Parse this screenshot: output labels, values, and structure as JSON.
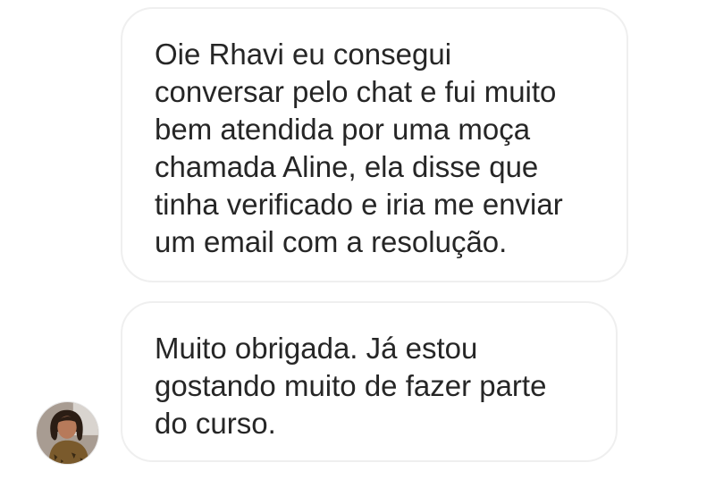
{
  "conversation": {
    "messages": [
      {
        "sender": "other",
        "text": "Oie Rhavi eu consegui\nconversar pelo chat e fui muito\nbem atendida por  uma moça\nchamada Aline, ela disse que\ntinha verificado e iria me enviar\num email com a resolução."
      },
      {
        "sender": "other",
        "text": "Muito obrigada. Já estou\ngostando muito de fazer parte\ndo curso."
      }
    ],
    "avatar": {
      "icon": "user-avatar-photo",
      "colors": {
        "background": "#9a8f86",
        "hair": "#2b1d14",
        "skin": "#b77a5a",
        "clothing": "#7a5a2c"
      }
    }
  },
  "colors": {
    "bubble_border": "#efefef",
    "text": "#262626",
    "background": "#ffffff"
  }
}
